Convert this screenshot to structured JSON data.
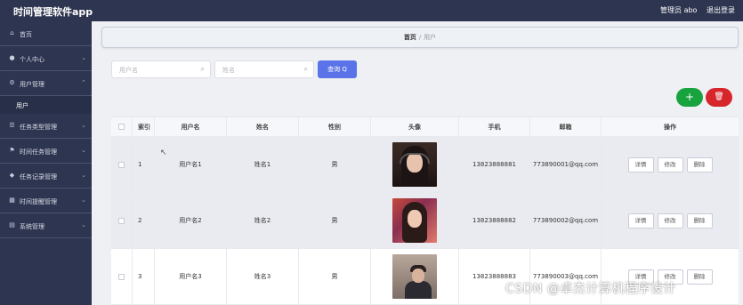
{
  "app": {
    "title": "时间管理软件app"
  },
  "topbar": {
    "user_label": "管理员 abo",
    "logout": "退出登录"
  },
  "sidebar": {
    "items": [
      {
        "label": "首页",
        "icon": "home-icon",
        "has_chevron": false
      },
      {
        "label": "个人中心",
        "icon": "user-icon",
        "has_chevron": true
      },
      {
        "label": "用户管理",
        "icon": "gear-icon",
        "has_chevron": true,
        "expanded": true,
        "children": [
          {
            "label": "用户"
          }
        ]
      },
      {
        "label": "任务类型管理",
        "icon": "list-icon",
        "has_chevron": true
      },
      {
        "label": "时间任务管理",
        "icon": "flag-icon",
        "has_chevron": true
      },
      {
        "label": "任务记录管理",
        "icon": "tag-icon",
        "has_chevron": true
      },
      {
        "label": "时间提醒管理",
        "icon": "grid-icon",
        "has_chevron": true
      },
      {
        "label": "系统管理",
        "icon": "system-icon",
        "has_chevron": true
      }
    ]
  },
  "breadcrumb": {
    "home": "首页",
    "sep": "/",
    "current": "用户"
  },
  "search": {
    "username_placeholder": "用户名",
    "name_placeholder": "姓名",
    "query_label": "查询 Q"
  },
  "actions": {
    "add": "+",
    "delete": "🗑"
  },
  "table": {
    "headers": {
      "index": "索引",
      "username": "用户名",
      "name": "姓名",
      "sex": "性别",
      "avatar": "头像",
      "phone": "手机",
      "email": "邮箱",
      "ops": "操作"
    },
    "rows": [
      {
        "index": "1",
        "username": "用户名1",
        "name": "姓名1",
        "sex": "男",
        "phone": "13823888881",
        "email": "773890001@qq.com"
      },
      {
        "index": "2",
        "username": "用户名2",
        "name": "姓名2",
        "sex": "男",
        "phone": "13823888882",
        "email": "773890002@qq.com"
      },
      {
        "index": "3",
        "username": "用户名3",
        "name": "姓名3",
        "sex": "男",
        "phone": "13823888883",
        "email": "773890003@qq.com"
      }
    ],
    "row_buttons": {
      "detail": "详情",
      "edit": "修改",
      "remove": "删除"
    }
  },
  "watermark": "CSDN @卓杰计算机程序设计"
}
